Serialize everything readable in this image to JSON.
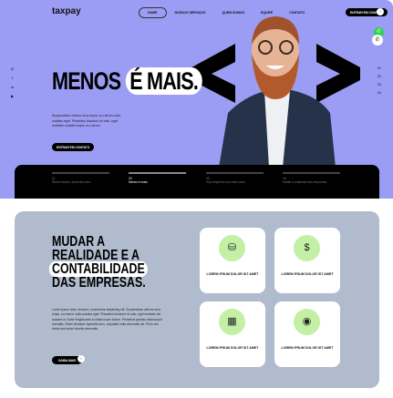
{
  "header": {
    "logo": "taxpay",
    "nav": [
      "HOME",
      "NOSSOS SERVIÇOS",
      "QUEM SOMOS",
      "EQUIPE",
      "CONTATO"
    ],
    "cta": "ENTRAR EM CONTATO",
    "cta_arrow": "›"
  },
  "hero": {
    "title_a": "MENOS",
    "title_b": "É MAIS.",
    "description": "Suspendisse ultrices urna turpis, eu rutrum nulla sodales eget. Phasellus tincidunt mi odio, eget molestie sodales turpis, eu rutrum.",
    "button": "ENTRAR EM CONTATO",
    "arrow": "›",
    "slides": [
      "01",
      "02",
      "03",
      "04"
    ],
    "social": [
      "instagram-icon",
      "facebook-icon",
      "linkedin-icon",
      "youtube-icon"
    ]
  },
  "steps": [
    {
      "n": "01.",
      "t": "Reduz tributo, aumenta lucro."
    },
    {
      "n": "02.",
      "t": "Menos é mais."
    },
    {
      "n": "03.",
      "t": "Sua empresa com mais valor."
    },
    {
      "n": "04.",
      "t": "Mudar a realidade das empresas."
    }
  ],
  "section2": {
    "title_1": "MUDAR A",
    "title_2": "REALIDADE E A",
    "title_3": "CONTABILIDADE",
    "title_4": "DAS EMPRESAS.",
    "text": "Lorem ipsum dolor sit amet, consectetur adipiscing elit. Suspendisse ultrices urna turpis, eu rutrum nulla sodales eget. Phasellus tincidunt mi odio, eget molestie est sodales id. Nulla fringilla ante id ullamcorper dictum. Phasellus gravida ullamcorper convallis. Etiam tincidunt imperdiet arcu, vulputate nulla venenatis vel. Proin nec lectus sed tortor lobortis venenatis.",
    "button": "SAIBA MAIS",
    "arrow": "›",
    "cards": [
      {
        "label": "LOREM IPSUM DOLOR SIT AMET",
        "icon": "coins-icon"
      },
      {
        "label": "LOREM IPSUM DOLOR SIT AMET",
        "icon": "invoice-icon"
      },
      {
        "label": "LOREM IPSUM DOLOR SIT AMET",
        "icon": "calculator-icon"
      },
      {
        "label": "LOREM IPSUM DOLOR SIT AMET",
        "icon": "chart-icon"
      }
    ]
  },
  "colors": {
    "hero": "#9b9cf4",
    "section": "#b0bccd",
    "icon_bg": "#c3f0a4"
  }
}
